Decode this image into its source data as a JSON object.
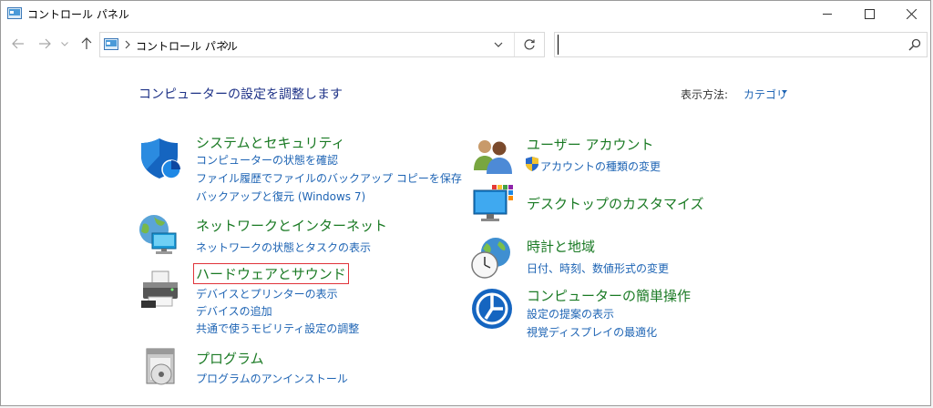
{
  "window": {
    "title": "コントロール パネル",
    "controls": {
      "minimize": "minimize-icon",
      "maximize": "maximize-icon",
      "close": "close-icon"
    }
  },
  "address": {
    "breadcrumb": "コントロール パネル",
    "search_value": ""
  },
  "content": {
    "title": "コンピューターの設定を調整します",
    "view_label": "表示方法:",
    "view_value": "カテゴリ"
  },
  "categories_left": [
    {
      "title": "システムとセキュリティ",
      "icon": "shield-icon",
      "links": [
        "コンピューターの状態を確認",
        "ファイル履歴でファイルのバックアップ コピーを保存",
        "バックアップと復元 (Windows 7)"
      ]
    },
    {
      "title": "ネットワークとインターネット",
      "icon": "network-icon",
      "links": [
        "ネットワークの状態とタスクの表示"
      ]
    },
    {
      "title": "ハードウェアとサウンド",
      "icon": "printer-icon",
      "links": [
        "デバイスとプリンターの表示",
        "デバイスの追加",
        "共通で使うモビリティ設定の調整"
      ]
    },
    {
      "title": "プログラム",
      "icon": "programs-icon",
      "links": [
        "プログラムのアンインストール"
      ]
    }
  ],
  "categories_right": [
    {
      "title": "ユーザー アカウント",
      "icon": "users-icon",
      "links": [
        "アカウントの種類の変更"
      ]
    },
    {
      "title": "デスクトップのカスタマイズ",
      "icon": "desktop-icon",
      "links": []
    },
    {
      "title": "時計と地域",
      "icon": "clock-globe-icon",
      "links": [
        "日付、時刻、数値形式の変更"
      ]
    },
    {
      "title": "コンピューターの簡単操作",
      "icon": "ease-of-access-icon",
      "links": [
        "設定の提案の表示",
        "視覚ディスプレイの最適化"
      ]
    }
  ],
  "colors": {
    "category_title": "#1a7a24",
    "link": "#1e64b4",
    "page_title": "#1e3287",
    "highlight_border": "#e0333a"
  }
}
